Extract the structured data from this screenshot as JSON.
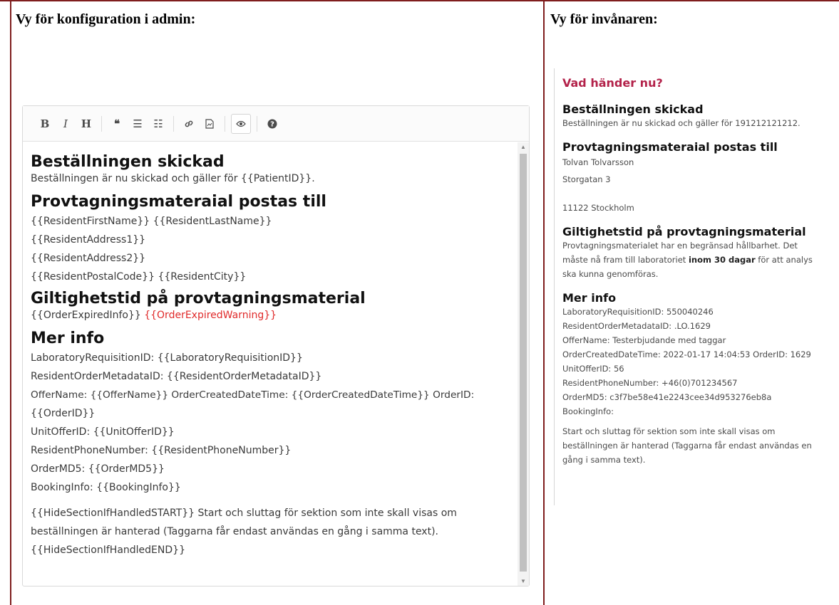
{
  "admin_title": "Vy för konfiguration i admin:",
  "resident_title": "Vy för invånaren:",
  "toolbar": {
    "bold": "B",
    "italic": "I",
    "heading": "H",
    "quote": "❝",
    "ul": "☰",
    "ol": "☷",
    "link": "🔗",
    "image": "🖼",
    "preview": "👁",
    "help": "?"
  },
  "editor": {
    "h1": "Beställningen skickad",
    "p1": "Beställningen är nu skickad och gäller för {{PatientID}}.",
    "h2": "Provtagningsmateraial postas till",
    "addr1": "{{ResidentFirstName}} {{ResidentLastName}}",
    "addr2": "{{ResidentAddress1}}",
    "addr3": "{{ResidentAddress2}}",
    "addr4": "{{ResidentPostalCode}} {{ResidentCity}}",
    "h3": "Giltighetstid på provtagningsmaterial",
    "expired_info": "{{OrderExpiredInfo}}",
    "expired_warning": "{{OrderExpiredWarning}}",
    "h4": "Mer info",
    "info1": "LaboratoryRequisitionID: {{LaboratoryRequisitionID}}",
    "info2": "ResidentOrderMetadataID: {{ResidentOrderMetadataID}}",
    "info3": "OfferName: {{OfferName}} OrderCreatedDateTime: {{OrderCreatedDateTime}} OrderID:",
    "info3b": "{{OrderID}}",
    "info4": "UnitOfferID: {{UnitOfferID}}",
    "info5": "ResidentPhoneNumber: {{ResidentPhoneNumber}}",
    "info6": "OrderMD5: {{OrderMD5}}",
    "info7": "BookingInfo: {{BookingInfo}}",
    "hide1": "{{HideSectionIfHandledSTART}} Start och sluttag för sektion som inte skall visas om",
    "hide2": "beställningen är hanterad (Taggarna får endast användas en gång i samma text).",
    "hide3": "{{HideSectionIfHandledEND}}"
  },
  "resident": {
    "kicker": "Vad händer nu?",
    "h1": "Beställningen skickad",
    "p1": "Beställningen är nu skickad och gäller för 191212121212.",
    "h2": "Provtagningsmateraial postas till",
    "addr1": "Tolvan Tolvarsson",
    "addr2": "Storgatan 3",
    "addr4": "11122 Stockholm",
    "h3": "Giltighetstid på provtagningsmaterial",
    "valid1": "Provtagningsmaterialet har en begränsad hållbarhet. Det",
    "valid2a": "måste nå fram till laboratoriet ",
    "valid2b": "inom 30 dagar",
    "valid2c": " för att analys",
    "valid3": "ska kunna genomföras.",
    "h4": "Mer info",
    "info1": "LaboratoryRequisitionID: 550040246",
    "info2": "ResidentOrderMetadataID: .LO.1629",
    "info3": "OfferName: Testerbjudande med taggar",
    "info4": "OrderCreatedDateTime: 2022-01-17 14:04:53 OrderID: 1629",
    "info5": "UnitOfferID: 56",
    "info6": "ResidentPhoneNumber: +46(0)701234567",
    "info7": "OrderMD5: c3f7be58e41e2243cee34d953276eb8a",
    "info8": "BookingInfo:",
    "hide1": "Start och sluttag för sektion som inte skall visas om",
    "hide2": "beställningen är hanterad (Taggarna får endast användas en",
    "hide3": "gång i samma text)."
  }
}
